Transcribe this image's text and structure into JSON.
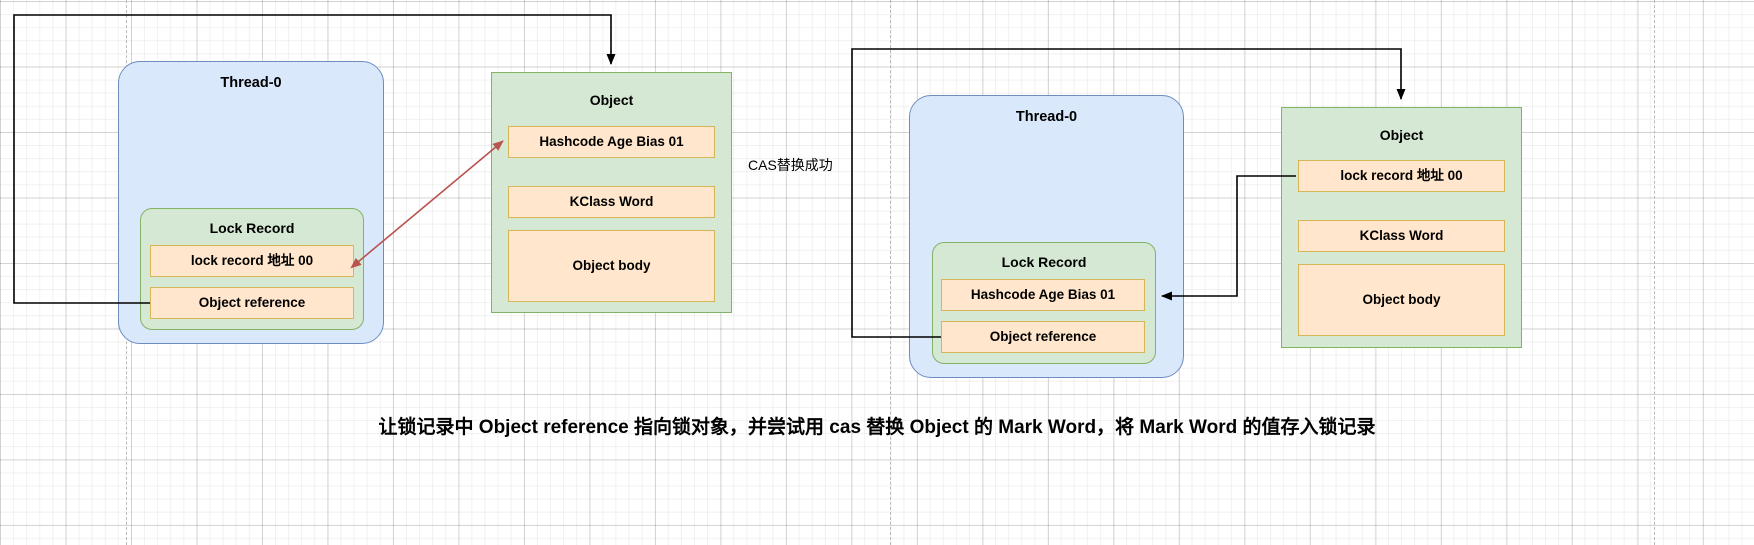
{
  "diagram": {
    "title_caption": "让锁记录中 Object reference 指向锁对象，并尝试用 cas 替换 Object 的 Mark Word，将 Mark Word 的值存入锁记录",
    "middle_label": "CAS替换成功",
    "colors": {
      "thread_fill": "#dae8fc",
      "thread_stroke": "#6c8ebf",
      "lock_record_fill": "#d5e8d4",
      "lock_record_stroke": "#82b366",
      "field_fill": "#ffe6cc",
      "field_stroke": "#d6b656",
      "arrow_black": "#000000",
      "arrow_red": "#b85450",
      "grid": "#d0d0d0"
    },
    "left": {
      "thread": {
        "title": "Thread-0",
        "lock_record": {
          "title": "Lock Record",
          "fields": [
            {
              "label": "lock record 地址 00"
            },
            {
              "label": "Object reference"
            }
          ]
        }
      },
      "object": {
        "title": "Object",
        "fields": [
          {
            "label": "Hashcode Age Bias 01"
          },
          {
            "label": "KClass Word"
          },
          {
            "label": "Object body"
          }
        ]
      }
    },
    "right": {
      "thread": {
        "title": "Thread-0",
        "lock_record": {
          "title": "Lock Record",
          "fields": [
            {
              "label": "Hashcode Age Bias 01"
            },
            {
              "label": "Object reference"
            }
          ]
        }
      },
      "object": {
        "title": "Object",
        "fields": [
          {
            "label": "lock record 地址 00"
          },
          {
            "label": "KClass Word"
          },
          {
            "label": "Object body"
          }
        ]
      }
    }
  }
}
